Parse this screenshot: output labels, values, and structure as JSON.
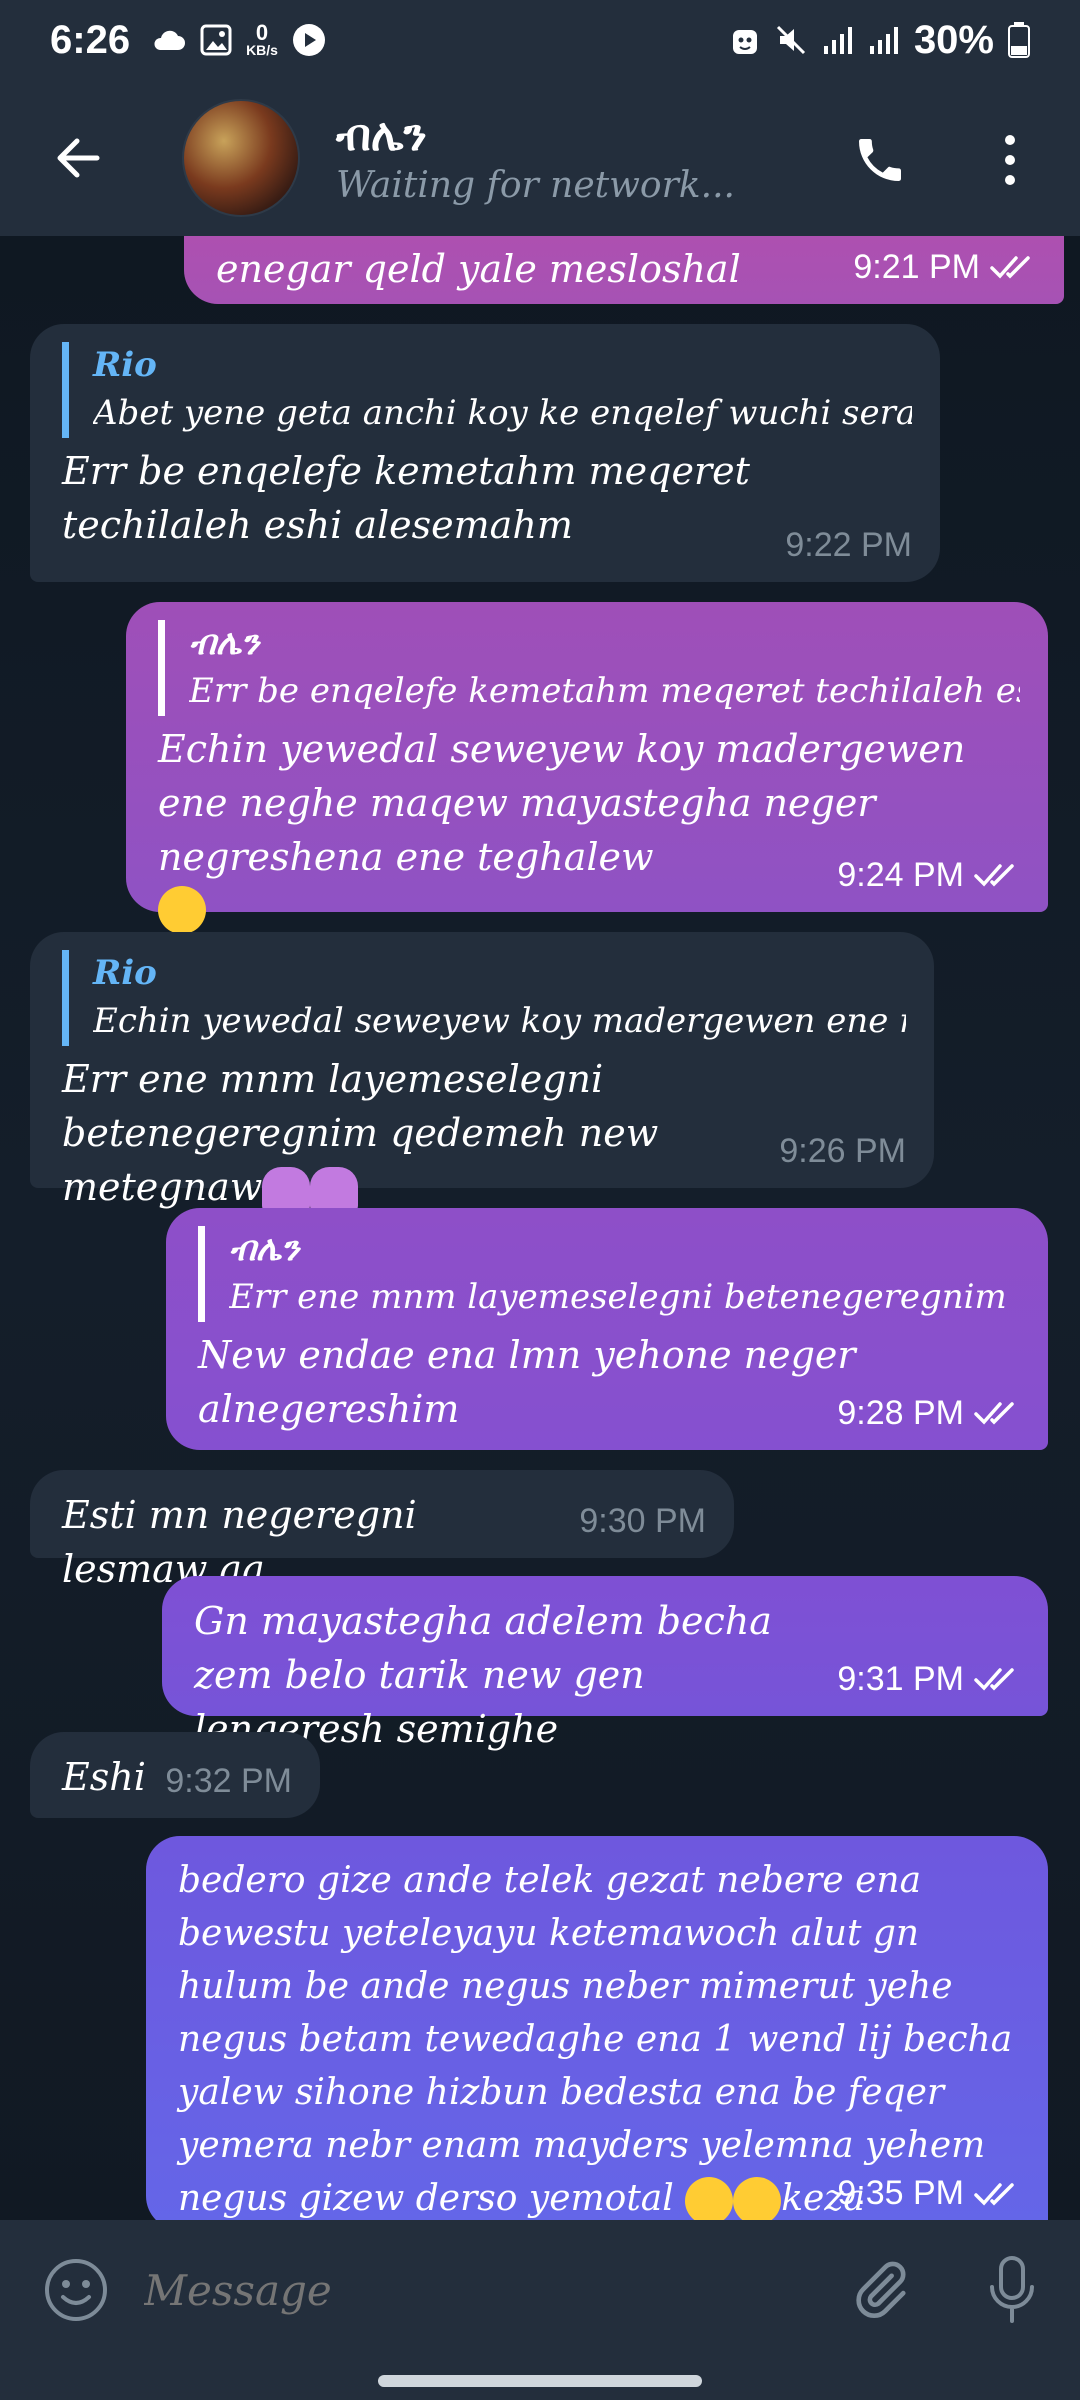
{
  "status_bar": {
    "time": "6:26",
    "net_speed_value": "0",
    "net_speed_unit": "KB/s",
    "battery": "30%"
  },
  "header": {
    "title": "ብሌን",
    "status": "Waiting for network..."
  },
  "messages": [
    {
      "id": "m1",
      "direction": "out",
      "text": "enegar qeld yale mesloshal",
      "time": "9:21 PM",
      "read": true
    },
    {
      "id": "m2",
      "direction": "in",
      "reply_name": "Rio",
      "reply_text": "Abet yene geta anchi koy ke enqelef wuchi sera yeleshi...",
      "text": "Err be enqelefe kemetahm meqeret techilaleh eshi alesemahm",
      "time": "9:22 PM"
    },
    {
      "id": "m3",
      "direction": "out",
      "reply_name": "ብሌን",
      "reply_text": "Err be enqelefe kemetahm meqeret techilaleh eshi alese...",
      "text": "Echin yewedal seweyew koy madergewen ene neghe maqew mayastegha neger negreshena ene teghalew",
      "time": "9:24 PM",
      "read": true
    },
    {
      "id": "m4",
      "direction": "in",
      "reply_name": "Rio",
      "reply_text": "Echin yewedal seweyew koy madergewen ene neghe m...",
      "text": "Err ene mnm layemeselegni betenegeregnim qedemeh new metegnaw",
      "time": "9:26 PM"
    },
    {
      "id": "m5",
      "direction": "out",
      "reply_name": "ብሌን",
      "reply_text": "Err ene mnm layemeselegni betenegeregnim qedemeh...",
      "text": "New endae ena lmn yehone neger alnegereshim",
      "time": "9:28 PM",
      "read": true
    },
    {
      "id": "m6",
      "direction": "in",
      "text": "Esti mn negeregni lesmaw aa",
      "time": "9:30 PM"
    },
    {
      "id": "m7",
      "direction": "out",
      "text": "Gn mayastegha adelem becha zem belo tarik new gen lengeresh semighe",
      "time": "9:31 PM",
      "read": true
    },
    {
      "id": "m8",
      "direction": "in",
      "text": "Eshi",
      "time": "9:32 PM"
    },
    {
      "id": "m9",
      "direction": "out",
      "text": "bedero gize ande telek gezat nebere ena bewestu yeteleyayu ketemawoch alut gn hulum be ande negus neber mimerut yehe negus betam tewedaghe ena 1 wend lij becha yalew sihone hizbun bedesta ena be feqer yemera nebr enam mayders yelemna yehem negus gizew derso yemotal",
      "text_suffix": "keza",
      "time": "9:35 PM",
      "read": true
    }
  ],
  "composer": {
    "placeholder": "Message"
  },
  "colors": {
    "header_bg": "#232e3c",
    "incoming_bubble": "#232e3c",
    "reply_accent": "#64b5f6",
    "outgoing_gradient_top": "#a24fb0",
    "outgoing_gradient_bottom": "#6a6ae8"
  },
  "icons": [
    "back-arrow-icon",
    "phone-icon",
    "more-vertical-icon",
    "emoji-icon",
    "attach-icon",
    "mic-icon",
    "double-check-icon"
  ]
}
